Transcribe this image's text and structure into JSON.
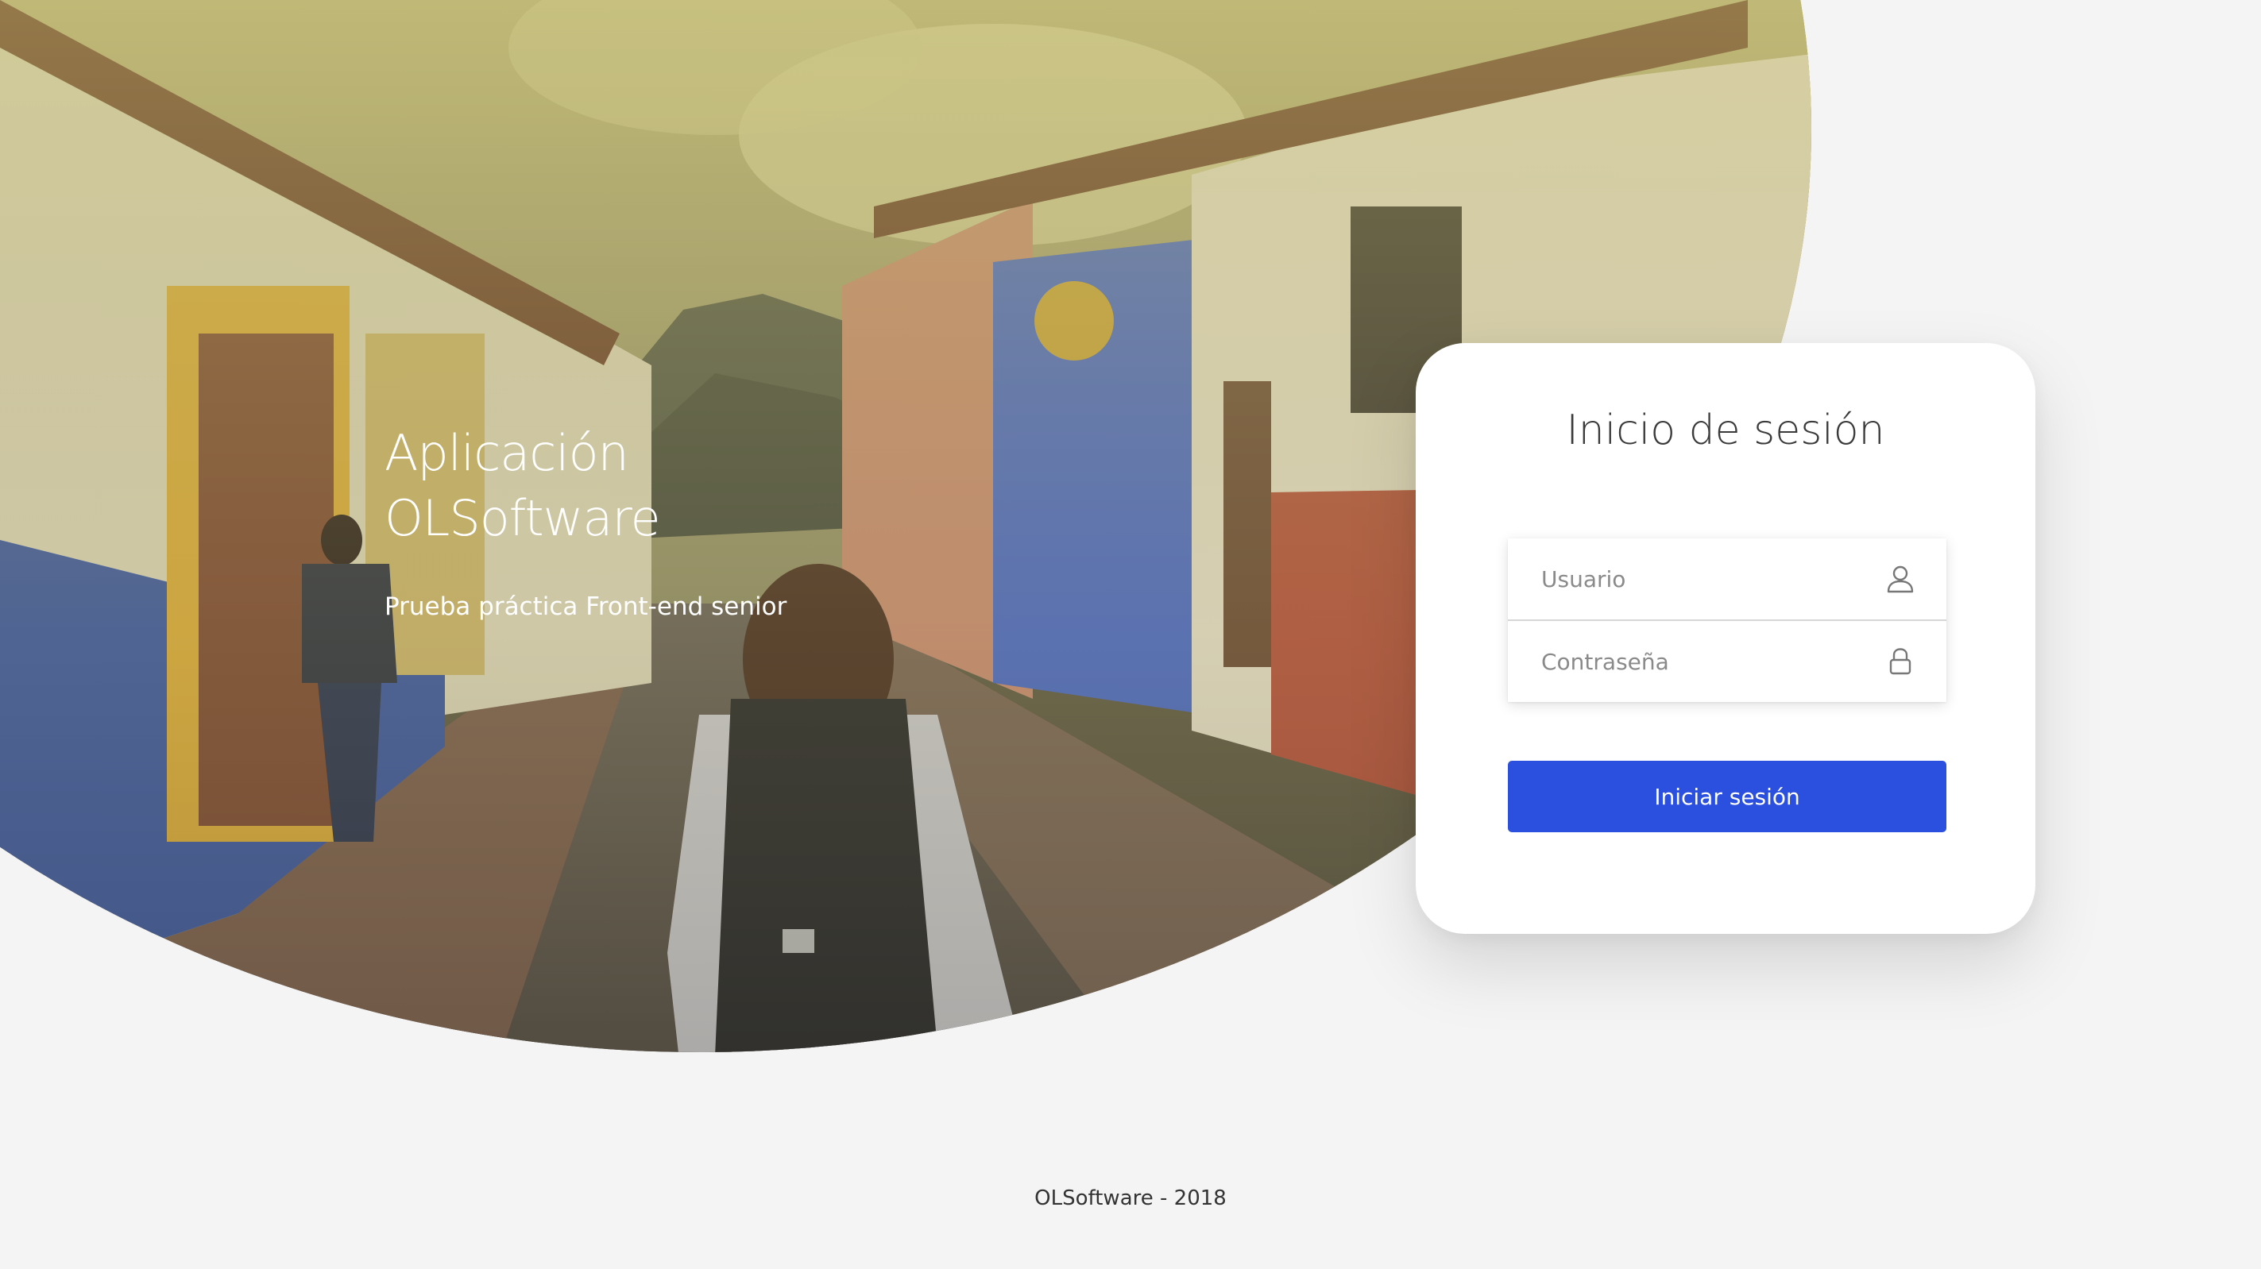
{
  "hero": {
    "title": "Aplicación OLSoftware",
    "subtitle": "Prueba práctica Front-end senior"
  },
  "login": {
    "title": "Inicio de sesión",
    "username_placeholder": "Usuario",
    "username_value": "",
    "password_placeholder": "Contraseña",
    "password_value": "",
    "submit_label": "Iniciar sesión",
    "username_icon": "user-icon",
    "password_icon": "lock-icon"
  },
  "footer": {
    "text": "OLSoftware - 2018"
  },
  "colors": {
    "background": "#f4f4f4",
    "primary_button": "#2b4fde",
    "card": "#ffffff"
  }
}
